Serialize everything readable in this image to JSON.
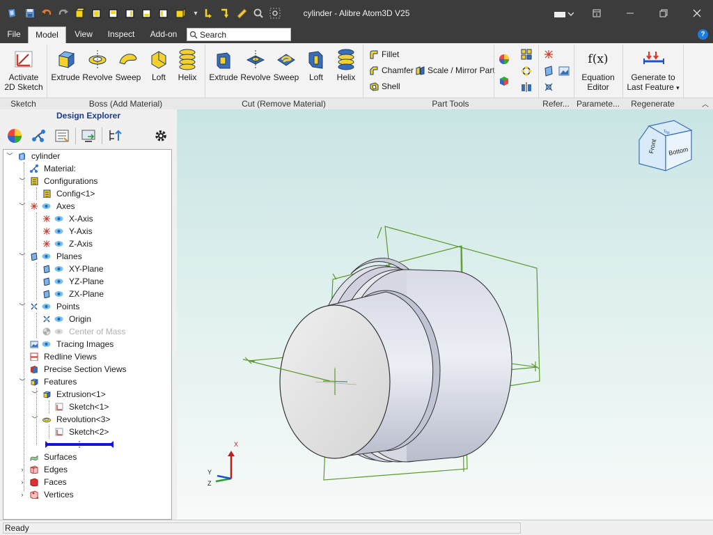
{
  "window": {
    "title": "cylinder - Alibre Atom3D V25"
  },
  "menu": {
    "tabs": [
      "File",
      "Model",
      "View",
      "Inspect",
      "Add-on"
    ],
    "active_tab": "Model",
    "search_label": "Search"
  },
  "ribbon": {
    "sketch": {
      "activate_line1": "Activate",
      "activate_line2": "2D Sketch",
      "group": "Sketch"
    },
    "boss": {
      "items": [
        "Extrude",
        "Revolve",
        "Sweep",
        "Loft",
        "Helix"
      ],
      "group": "Boss (Add Material)"
    },
    "cut": {
      "items": [
        "Extrude",
        "Revolve",
        "Sweep",
        "Loft",
        "Helix"
      ],
      "group": "Cut (Remove Material)"
    },
    "part_tools": {
      "fillet": "Fillet",
      "chamfer": "Chamfer",
      "scale_mirror": "Scale / Mirror Part",
      "shell": "Shell",
      "group": "Part Tools"
    },
    "reference_group": "Refer...",
    "parameters": {
      "label_line1": "Equation",
      "label_line2": "Editor",
      "icon_text": "f(x)",
      "group": "Paramete..."
    },
    "regenerate": {
      "label_line1": "Generate to",
      "label_line2": "Last Feature",
      "group": "Regenerate"
    }
  },
  "explorer": {
    "title": "Design Explorer",
    "tree": {
      "root": "cylinder",
      "material": "Material:",
      "configurations": "Configurations",
      "config1": "Config<1>",
      "axes": "Axes",
      "x_axis": "X-Axis",
      "y_axis": "Y-Axis",
      "z_axis": "Z-Axis",
      "planes": "Planes",
      "xy_plane": "XY-Plane",
      "yz_plane": "YZ-Plane",
      "zx_plane": "ZX-Plane",
      "points": "Points",
      "origin": "Origin",
      "center_of_mass": "Center of Mass",
      "tracing_images": "Tracing Images",
      "redline_views": "Redline Views",
      "precise_section_views": "Precise Section Views",
      "features": "Features",
      "extrusion1": "Extrusion<1>",
      "sketch1": "Sketch<1>",
      "revolution3": "Revolution<3>",
      "sketch2": "Sketch<2>",
      "surfaces": "Surfaces",
      "edges": "Edges",
      "faces": "Faces",
      "vertices": "Vertices"
    }
  },
  "viewport": {
    "view_cube": {
      "front": "Front",
      "bottom": "Bottom",
      "top": "Top"
    },
    "triad": {
      "x": "X",
      "y": "Y",
      "z": "Z"
    }
  },
  "status": {
    "text": "Ready"
  },
  "colors": {
    "titlebar": "#3c3c3c",
    "ribbon": "#f3f3f3",
    "sketch_green": "#5a9a2a",
    "rollback_bar": "#1414d4"
  }
}
